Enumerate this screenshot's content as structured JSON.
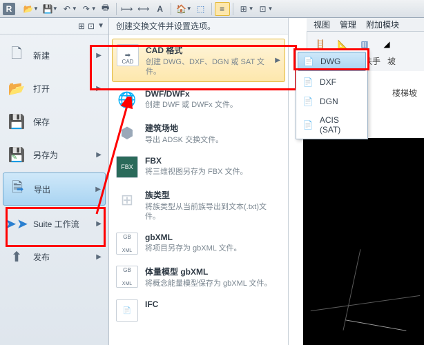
{
  "qat": {
    "logo": "R"
  },
  "tabs": {
    "view": "视图",
    "manage": "管理",
    "addin": "附加模块"
  },
  "ribbon_right": {
    "rail": "栏杆扶手",
    "slope": "坡"
  },
  "subpanel_label": "楼梯坡",
  "app_menu": {
    "new": "新建",
    "open": "打开",
    "save": "保存",
    "saveas": "另存为",
    "export": "导出",
    "suite": "Suite 工作流",
    "publish": "发布"
  },
  "sub": {
    "title": "创建交换文件并设置选项。",
    "cad": {
      "name": "CAD 格式",
      "desc": "创建 DWG、DXF、DGN 或 SAT 文件。"
    },
    "dwf": {
      "name": "DWF/DWFx",
      "desc": "创建 DWF 或 DWFx 文件。"
    },
    "site": {
      "name": "建筑场地",
      "desc": "导出 ADSK 交换文件。"
    },
    "fbx": {
      "name": "FBX",
      "desc": "将三维视图另存为 FBX 文件。"
    },
    "famtype": {
      "name": "族类型",
      "desc": "将族类型从当前族导出到文本(.txt)文件。"
    },
    "gbxml": {
      "name": "gbXML",
      "desc": "将项目另存为 gbXML 文件。"
    },
    "mass": {
      "name": "体量模型 gbXML",
      "desc": "将概念能量模型保存为 gbXML 文件。"
    },
    "ifc": {
      "name": "IFC",
      "desc": ""
    }
  },
  "fly": {
    "dwg": "DWG",
    "dxf": "DXF",
    "dgn": "DGN",
    "acis": "ACIS (SAT)"
  },
  "icons": {
    "cad_tag": "CAD",
    "fbx_tag": "FBX",
    "gb_tag": "GB",
    "gbxml_tag": "XML"
  }
}
